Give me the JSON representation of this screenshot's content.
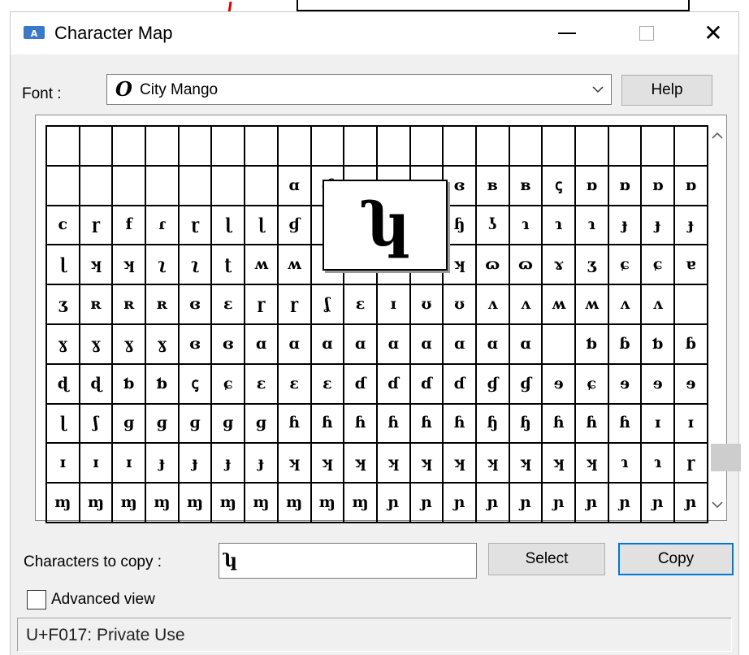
{
  "window": {
    "title": "Character Map",
    "minimize_icon": "minimize-icon",
    "maximize_icon": "maximize-icon",
    "close_icon": "close-icon",
    "close_glyph": "✕"
  },
  "font": {
    "label": "Font :",
    "preview_glyph": "O",
    "selected": "City Mango",
    "help_label": "Help"
  },
  "grid": {
    "rows": [
      [
        "",
        "",
        "",
        "",
        "",
        "",
        "",
        "",
        "",
        "",
        "",
        "",
        "",
        "",
        "",
        "",
        "",
        "",
        "",
        ""
      ],
      [
        "",
        "",
        "",
        "",
        "",
        "",
        "",
        "ɑ",
        "ɗ",
        "ᴂ",
        "ᴂ",
        "ᴂ",
        "ɞ",
        "ʙ",
        "ʙ",
        "ꞔ",
        "ɒ",
        "ɒ",
        "ɒ",
        "ɒ"
      ],
      [
        "c",
        "ɼ",
        "f",
        "ɾ",
        "ɽ",
        "ɭ",
        "ɭ",
        "ɠ",
        "ɟ",
        "ʮ",
        "ʮ",
        "ʮ",
        "ɧ",
        "ʖ",
        "ɿ",
        "ɿ",
        "ɿ",
        "ɟ",
        "ɟ",
        "ɟ"
      ],
      [
        "ɭ",
        "ʞ",
        "ʞ",
        "ʅ",
        "ʅ",
        "ʈ",
        "ʍ",
        "ʍ",
        "ɑ",
        "ɑ",
        "ɑ",
        "ɑ",
        "ʞ",
        "ɷ",
        "ɷ",
        "ɤ",
        "ʒ",
        "ɕ",
        "ɕ",
        "ɐ"
      ],
      [
        "ʒ",
        "ʀ",
        "ʀ",
        "ʀ",
        "ɞ",
        "ɛ",
        "ɼ",
        "ɼ",
        "ʆ",
        "ɛ",
        "ɪ",
        "ʊ",
        "ʊ",
        "ʌ",
        "ʌ",
        "ʍ",
        "ʍ",
        "ʌ",
        "ʌ"
      ],
      [
        "ɣ",
        "ɣ",
        "ɣ",
        "ɣ",
        "ɞ",
        "ɞ",
        "ɑ",
        "ɑ",
        "ɑ",
        "ɑ",
        "ɑ",
        "ɑ",
        "ɑ",
        "ɑ",
        "ɑ",
        "",
        "ƅ",
        "ɓ",
        "ƅ",
        "ɓ"
      ],
      [
        "ɖ",
        "ɖ",
        "ƅ",
        "ƅ",
        "ꞔ",
        "ɕ",
        "ɛ",
        "ɛ",
        "ɛ",
        "ɗ",
        "ɗ",
        "ɗ",
        "ɗ",
        "ɠ",
        "ɠ",
        "ɘ",
        "ɕ",
        "ɘ",
        "ɘ",
        "ɘ"
      ],
      [
        "ɭ",
        "ʃ",
        "ɡ",
        "ɡ",
        "ɡ",
        "ɡ",
        "ɡ",
        "ɦ",
        "ɦ",
        "ɦ",
        "ɦ",
        "ɦ",
        "ɦ",
        "ɧ",
        "ɧ",
        "ɦ",
        "ɦ",
        "ɦ",
        "ɪ",
        "ɪ"
      ],
      [
        "ɪ",
        "ɪ",
        "ɪ",
        "ɟ",
        "ɟ",
        "ɟ",
        "ɟ",
        "ʞ",
        "ʞ",
        "ʞ",
        "ʞ",
        "ʞ",
        "ʞ",
        "ʞ",
        "ʞ",
        "ʞ",
        "ʞ",
        "ɿ",
        "ɿ",
        "ɼ"
      ],
      [
        "ɱ",
        "ɱ",
        "ɱ",
        "ɱ",
        "ɱ",
        "ɱ",
        "ɱ",
        "ɱ",
        "ɱ",
        "ɱ",
        "ɲ",
        "ɲ",
        "ɲ",
        "ɲ",
        "ɲ",
        "ɲ",
        "ɲ",
        "ɲ",
        "ɲ",
        "ɲ"
      ]
    ],
    "scroll_up_icon": "chevron-up-icon",
    "scroll_down_icon": "chevron-down-icon"
  },
  "magnifier": {
    "glyph": "ʮ"
  },
  "copy": {
    "label": "Characters to copy :",
    "value": "ʮ",
    "select_label": "Select",
    "copy_label": "Copy"
  },
  "advanced": {
    "label": "Advanced view",
    "checked": false
  },
  "status": {
    "text": "U+F017: Private Use"
  },
  "colors": {
    "accent": "#0078d7",
    "callout_arrow": "#e00000",
    "window_bg": "#f0f0f0"
  }
}
